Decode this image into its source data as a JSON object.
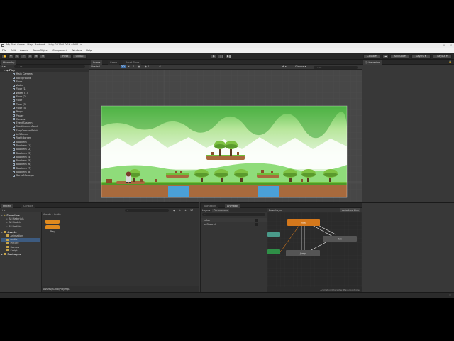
{
  "window": {
    "title": "My First Game - Play - Android - Unity 2019.4.0f1* <DX11>"
  },
  "menu": [
    "File",
    "Edit",
    "Assets",
    "GameObject",
    "Component",
    "Window",
    "Help"
  ],
  "toolbar": {
    "pivot": "Pivot",
    "global": "Global",
    "collab": "Collab ▾",
    "account": "Account ▾",
    "layers": "Layers ▾",
    "layout": "Layout ▾"
  },
  "hierarchy": {
    "tab": "Hierarchy",
    "search_placeholder": "All",
    "scene": "Play",
    "items": [
      "Main Camera",
      "Background",
      "Floor",
      "Water",
      "Floor (1)",
      "Water (1)",
      "Floor (2)",
      "Floor",
      "Floor (3)",
      "Floor (4)",
      "Props",
      "Player",
      "Canvas",
      "EventSystem",
      "StartCameraPoint",
      "StopCameraPoint",
      "LeftBorder",
      "RightBorder",
      "Boolkem",
      "Boolkem (1)",
      "Boolkem (2)",
      "Boolkem (3)",
      "Boolkem (4)",
      "Boolkem (5)",
      "Boolkem (6)",
      "Boolkem (7)",
      "Boolkem (8)",
      "GameManager"
    ]
  },
  "scene": {
    "tabs": [
      "Scene",
      "Game",
      "Asset Store"
    ],
    "shading": "Shaded",
    "mode": "2D",
    "gizmos": "Gizmos ▾",
    "search_placeholder": "All"
  },
  "inspector": {
    "tab": "Inspector"
  },
  "project": {
    "tabs": [
      "Project",
      "Console"
    ],
    "count": "17",
    "favorites_label": "Favorites",
    "favorites": [
      "All Materials",
      "All Models",
      "All Prefabs"
    ],
    "assets_label": "Assets",
    "asset_folders": [
      "Animation",
      "Audio",
      "Picture",
      "Scenes",
      "Script"
    ],
    "packages_label": "Packages",
    "breadcrumb": [
      "Assets",
      "Audio"
    ],
    "file_name": "Play",
    "status_path": "Assets/Audio/Play.mp3"
  },
  "animator": {
    "tabs": [
      "Animation",
      "Animator"
    ],
    "subtabs": [
      "Layers",
      "Parameters"
    ],
    "layer_name": "Base Layer",
    "auto_live": "Auto Live Link",
    "params": [
      "isRun",
      "onGround"
    ],
    "footer": "Animation/Character/Player.controller",
    "states": [
      "Idle",
      "Jump",
      "Run"
    ]
  },
  "colors": {
    "accent": "#3d6ea8",
    "sky": "#cdeaa6",
    "grass": "#6fbf3a",
    "dirt": "#a86a3d",
    "state_orange": "#d4781c",
    "state_green": "#2f8f47",
    "folder": "#c9a64a"
  }
}
